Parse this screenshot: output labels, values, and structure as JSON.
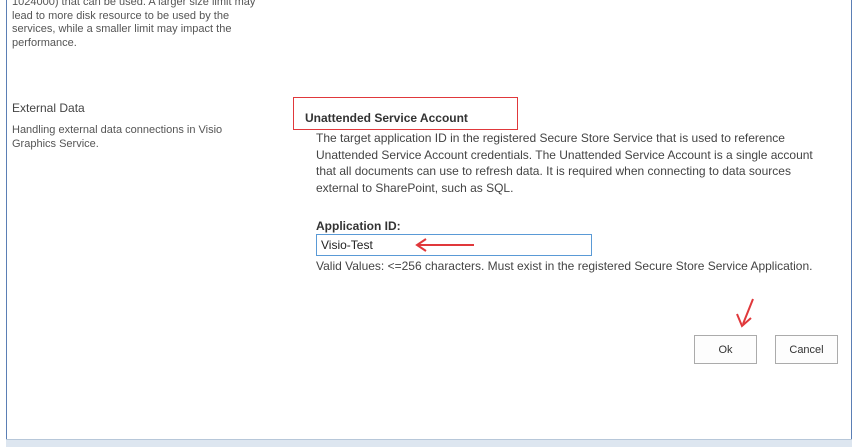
{
  "previous_section": {
    "description": "1024000) that can be used. A larger size limit may lead to more disk resource to be used by the services, while a smaller limit may impact the performance."
  },
  "external_data": {
    "title": "External Data",
    "description": "Handling external data connections in Visio Graphics Service."
  },
  "unattended": {
    "heading": "Unattended Service Account",
    "description": "The target application ID in the registered Secure Store Service that is used to reference Unattended Service Account credentials. The Unattended Service Account is a single account that all documents can use to refresh data. It is required when connecting to data sources external to SharePoint, such as SQL.",
    "app_id_label": "Application ID:",
    "app_id_value": "Visio-Test",
    "valid_values": "Valid Values: <=256 characters. Must exist in the registered Secure Store Service Application."
  },
  "buttons": {
    "ok": "Ok",
    "cancel": "Cancel"
  },
  "annotation_color": "#e0383b"
}
